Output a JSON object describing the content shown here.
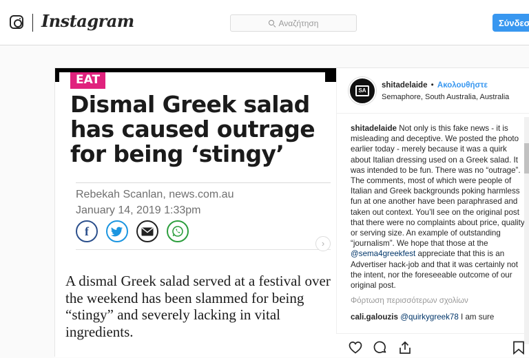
{
  "nav": {
    "logo_text": "Instagram",
    "search_placeholder": "Αναζήτηση",
    "login_label": "Σύνδεση"
  },
  "article": {
    "category": "EAT",
    "headline": "Dismal Greek salad has caused outrage for being ‘stingy’",
    "byline": "Rebekah Scanlan, news.com.au",
    "date": "January 14, 2019 1:33pm",
    "share_icons": [
      "facebook-icon",
      "twitter-icon",
      "email-icon",
      "whatsapp-icon"
    ],
    "body": "A dismal Greek salad served at a festival over the weekend has been slammed for being “stingy” and severely lacking in vital ingredients."
  },
  "post": {
    "username": "shitadelaide",
    "separator": "•",
    "follow_label": "Ακολουθήστε",
    "location": "Semaphore, South Australia, Australia",
    "caption_part1": "Not only is this fake news - it is misleading and deceptive. We posted the photo earlier today - merely because it was a quirk about Italian dressing used on a Greek salad. It was intended to be fun. There was no “outrage”. The comments, most of which were people of Italian and Greek backgrounds poking harmless fun at one another have been paraphrased and taken out context. You’ll see on the original post that there were no complaints about price, quality or serving size. An example of outstanding “journalism”. We hope that those at the",
    "caption_mention": "@sema4greekfest",
    "caption_part2": "appreciate that this is an Advertiser hack-job and that it was certainly not the intent, nor the foreseeable outcome of our original post.",
    "load_more": "Φόρτωση περισσότερων σχολίων",
    "comment": {
      "user": "cali.galouzis",
      "mention": "@quirkygreek78",
      "text": "I am sure"
    }
  },
  "colors": {
    "accent_blue": "#3897f0",
    "category_pink": "#e0227d"
  }
}
